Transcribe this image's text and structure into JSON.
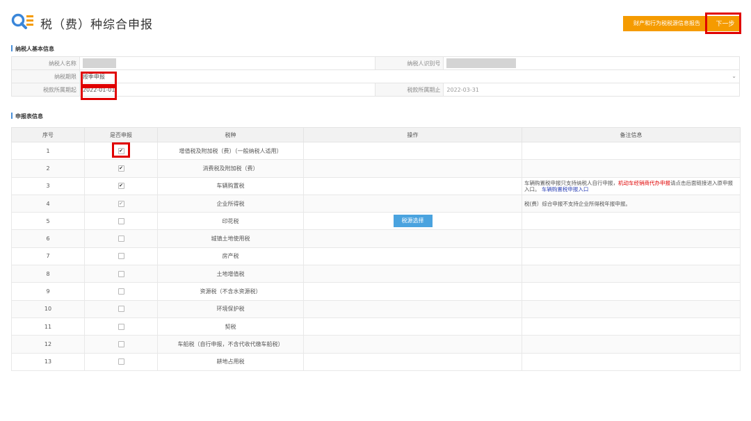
{
  "header": {
    "title": "税（费）种综合申报",
    "report_button": "财产和行为税税源信息报告",
    "next_button": "下一步"
  },
  "taxpayer_section": {
    "title": "纳税人基本信息",
    "name_label": "纳税人名称",
    "id_label": "纳税人识别号",
    "period_label": "纳税期限",
    "period_value": "按季申报",
    "start_label": "税款所属期起",
    "start_value": "2022-01-01",
    "end_label": "税款所属期止",
    "end_value": "2022-03-31"
  },
  "declaration_section": {
    "title": "申报表信息",
    "columns": [
      "序号",
      "是否申报",
      "税种",
      "操作",
      "备注信息"
    ],
    "rows": [
      {
        "no": "1",
        "tax": "增值税及附加税（费）（一般纳税人适用）"
      },
      {
        "no": "2",
        "tax": "消费税及附加税（费）"
      },
      {
        "no": "3",
        "tax": "车辆购置税"
      },
      {
        "no": "4",
        "tax": "企业所得税"
      },
      {
        "no": "5",
        "tax": "印花税"
      },
      {
        "no": "6",
        "tax": "城镇土地使用税"
      },
      {
        "no": "7",
        "tax": "房产税"
      },
      {
        "no": "8",
        "tax": "土地增值税"
      },
      {
        "no": "9",
        "tax": "资源税（不含水资源税）"
      },
      {
        "no": "10",
        "tax": "环境保护税"
      },
      {
        "no": "11",
        "tax": "契税"
      },
      {
        "no": "12",
        "tax": "车船税（自行申报，不含代收代缴车船税）"
      },
      {
        "no": "13",
        "tax": "耕地占用税"
      }
    ],
    "checked_rows": [
      1,
      2,
      3,
      4
    ],
    "source_select_button": "税源选择",
    "note_row3_a": "车辆购置税申报只支持纳税人自行申报，",
    "note_row3_red": "机动车经销商代办申报",
    "note_row3_b": "请点击后面链接进入原申报入口。",
    "note_row3_link": "车辆购置税申报入口",
    "note_row4": "税(费）综合申报不支持企业所得税年报申报。"
  },
  "icons": {
    "logo": "search-magnifier-list-icon",
    "dropdown": "chevron-down-icon",
    "checkbox": "checkbox-icon"
  },
  "colors": {
    "accent_orange": "#f59b00",
    "highlight_red": "#e00000",
    "button_blue": "#4aa3df",
    "link_blue": "#2a3fb5"
  }
}
